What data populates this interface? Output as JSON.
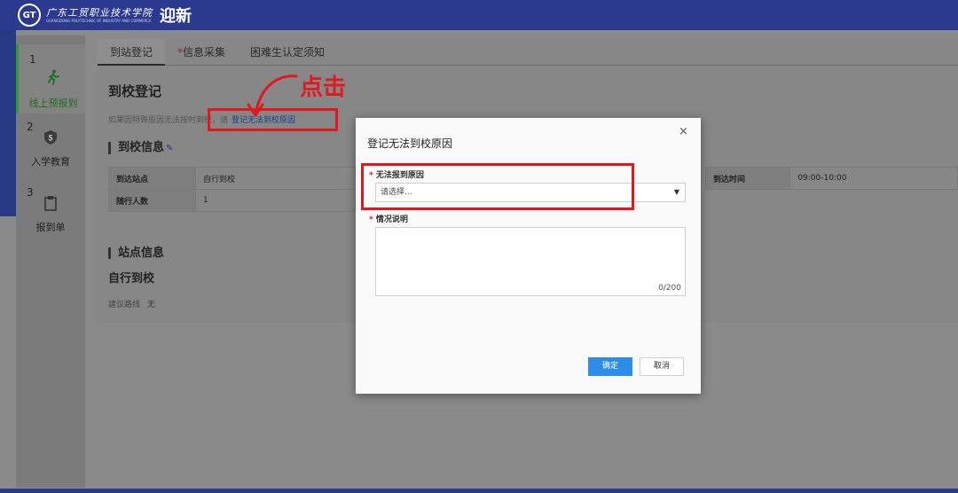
{
  "header": {
    "seal_text": "GT",
    "school_name_cn": "广东工贸职业技术学院",
    "school_name_en": "GUANGDONG POLYTECHNIC OF INDUSTRY AND COMMERCE",
    "app_title": "迎新"
  },
  "sidebar": {
    "steps": [
      {
        "num": "1",
        "label": "线上预报到",
        "icon": "walking-person-icon"
      },
      {
        "num": "2",
        "label": "入学教育",
        "icon": "shield-dollar-icon"
      },
      {
        "num": "3",
        "label": "报到单",
        "icon": "clipboard-icon"
      }
    ]
  },
  "main": {
    "tabs": [
      {
        "label": "到站登记",
        "required": false
      },
      {
        "label": "信息采集",
        "required": true
      },
      {
        "label": "困难生认定须知",
        "required": false
      }
    ],
    "title": "到校登记",
    "hint_text": "如果因特殊原因无法按时到校，请",
    "hint_link": "登记无法到校原因",
    "section_arrival": "到校信息",
    "arrival_rows": [
      {
        "key": "到达站点",
        "value": "自行到校"
      },
      {
        "key": "随行人数",
        "value": "1"
      }
    ],
    "arrival_time_key": "到达时间",
    "arrival_time_value": "09:00-10:00",
    "section_station": "站点信息",
    "station_name": "自行到校",
    "route_label": "建议路线",
    "route_value": "无"
  },
  "annotation": {
    "click_text": "点击",
    "color": "#e0191e"
  },
  "dialog": {
    "title": "登记无法到校原因",
    "close_symbol": "×",
    "reason_label": "无法报到原因",
    "reason_placeholder": "请选择...",
    "desc_label": "情况说明",
    "counter": "0/200",
    "ok_label": "确定",
    "cancel_label": "取消"
  }
}
